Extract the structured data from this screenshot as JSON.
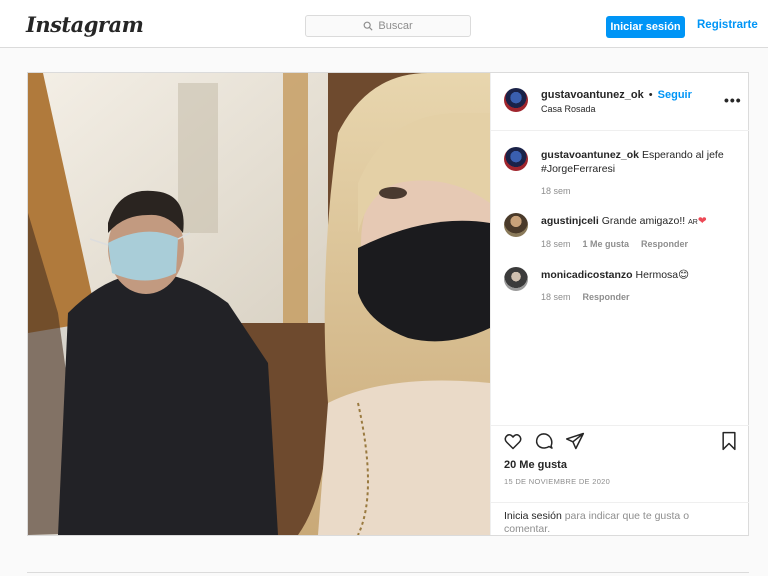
{
  "header": {
    "logo": "Instagram",
    "search_placeholder": "Buscar",
    "login_label": "Iniciar sesión",
    "register_label": "Registrarte"
  },
  "post": {
    "author": {
      "username": "gustavoantunez_ok",
      "follow_label": "Seguir",
      "location": "Casa Rosada"
    },
    "caption": {
      "username": "gustavoantunez_ok",
      "text_line1": "Esperando al jefe",
      "text_line2": "#JorgeFerraresi",
      "time": "18 sem"
    },
    "comments": [
      {
        "username": "agustinjceli",
        "text": "Grande amigazo!! ",
        "flag": "AR",
        "emoji": "❤",
        "time": "18 sem",
        "likes": "1 Me gusta",
        "reply_label": "Responder"
      },
      {
        "username": "monicadicostanzo",
        "text": "Hermosa",
        "emoji": "😊",
        "time": "18 sem",
        "reply_label": "Responder"
      }
    ],
    "likes": "20 Me gusta",
    "date": "15 DE NOVIEMBRE DE 2020",
    "login_note_link": "Inicia sesión",
    "login_note_line1": " para indicar que te gusta o",
    "login_note_line2": "comentar."
  },
  "colors": {
    "accent": "#0095f6",
    "border": "#dbdbdb",
    "background": "#fafafa",
    "heart": "#ed4956"
  },
  "icons": {
    "search": "search-icon",
    "more": "more-options-icon",
    "like": "heart-icon",
    "comment": "comment-icon",
    "share": "share-icon",
    "save": "bookmark-icon"
  }
}
